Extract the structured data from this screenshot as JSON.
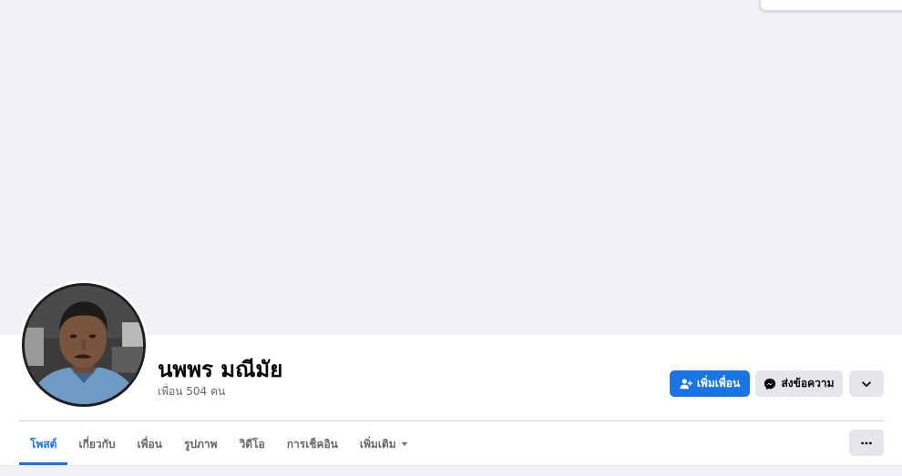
{
  "profile": {
    "name": "นพพร มณีมัย",
    "friends_count": "เพื่อน 504 คน"
  },
  "actions": {
    "add_friend": "เพิ่มเพื่อน",
    "send_message": "ส่งข้อความ"
  },
  "tabs": [
    {
      "label": "โพสต์",
      "active": true
    },
    {
      "label": "เกี่ยวกับ",
      "active": false
    },
    {
      "label": "เพื่อน",
      "active": false
    },
    {
      "label": "รูปภาพ",
      "active": false
    },
    {
      "label": "วิดีโอ",
      "active": false
    },
    {
      "label": "การเช็คอิน",
      "active": false
    },
    {
      "label": "เพิ่มเติม",
      "active": false,
      "dropdown": true
    }
  ],
  "icons": {
    "add_friend": "add-friend-icon",
    "messenger": "messenger-icon",
    "dropdown": "chevron-down-icon",
    "more": "ellipsis-icon"
  },
  "colors": {
    "accent": "#1b74e4",
    "cover_bg": "#f0f2f5",
    "secondary_button": "#e4e6eb",
    "muted_text": "#65676b"
  }
}
